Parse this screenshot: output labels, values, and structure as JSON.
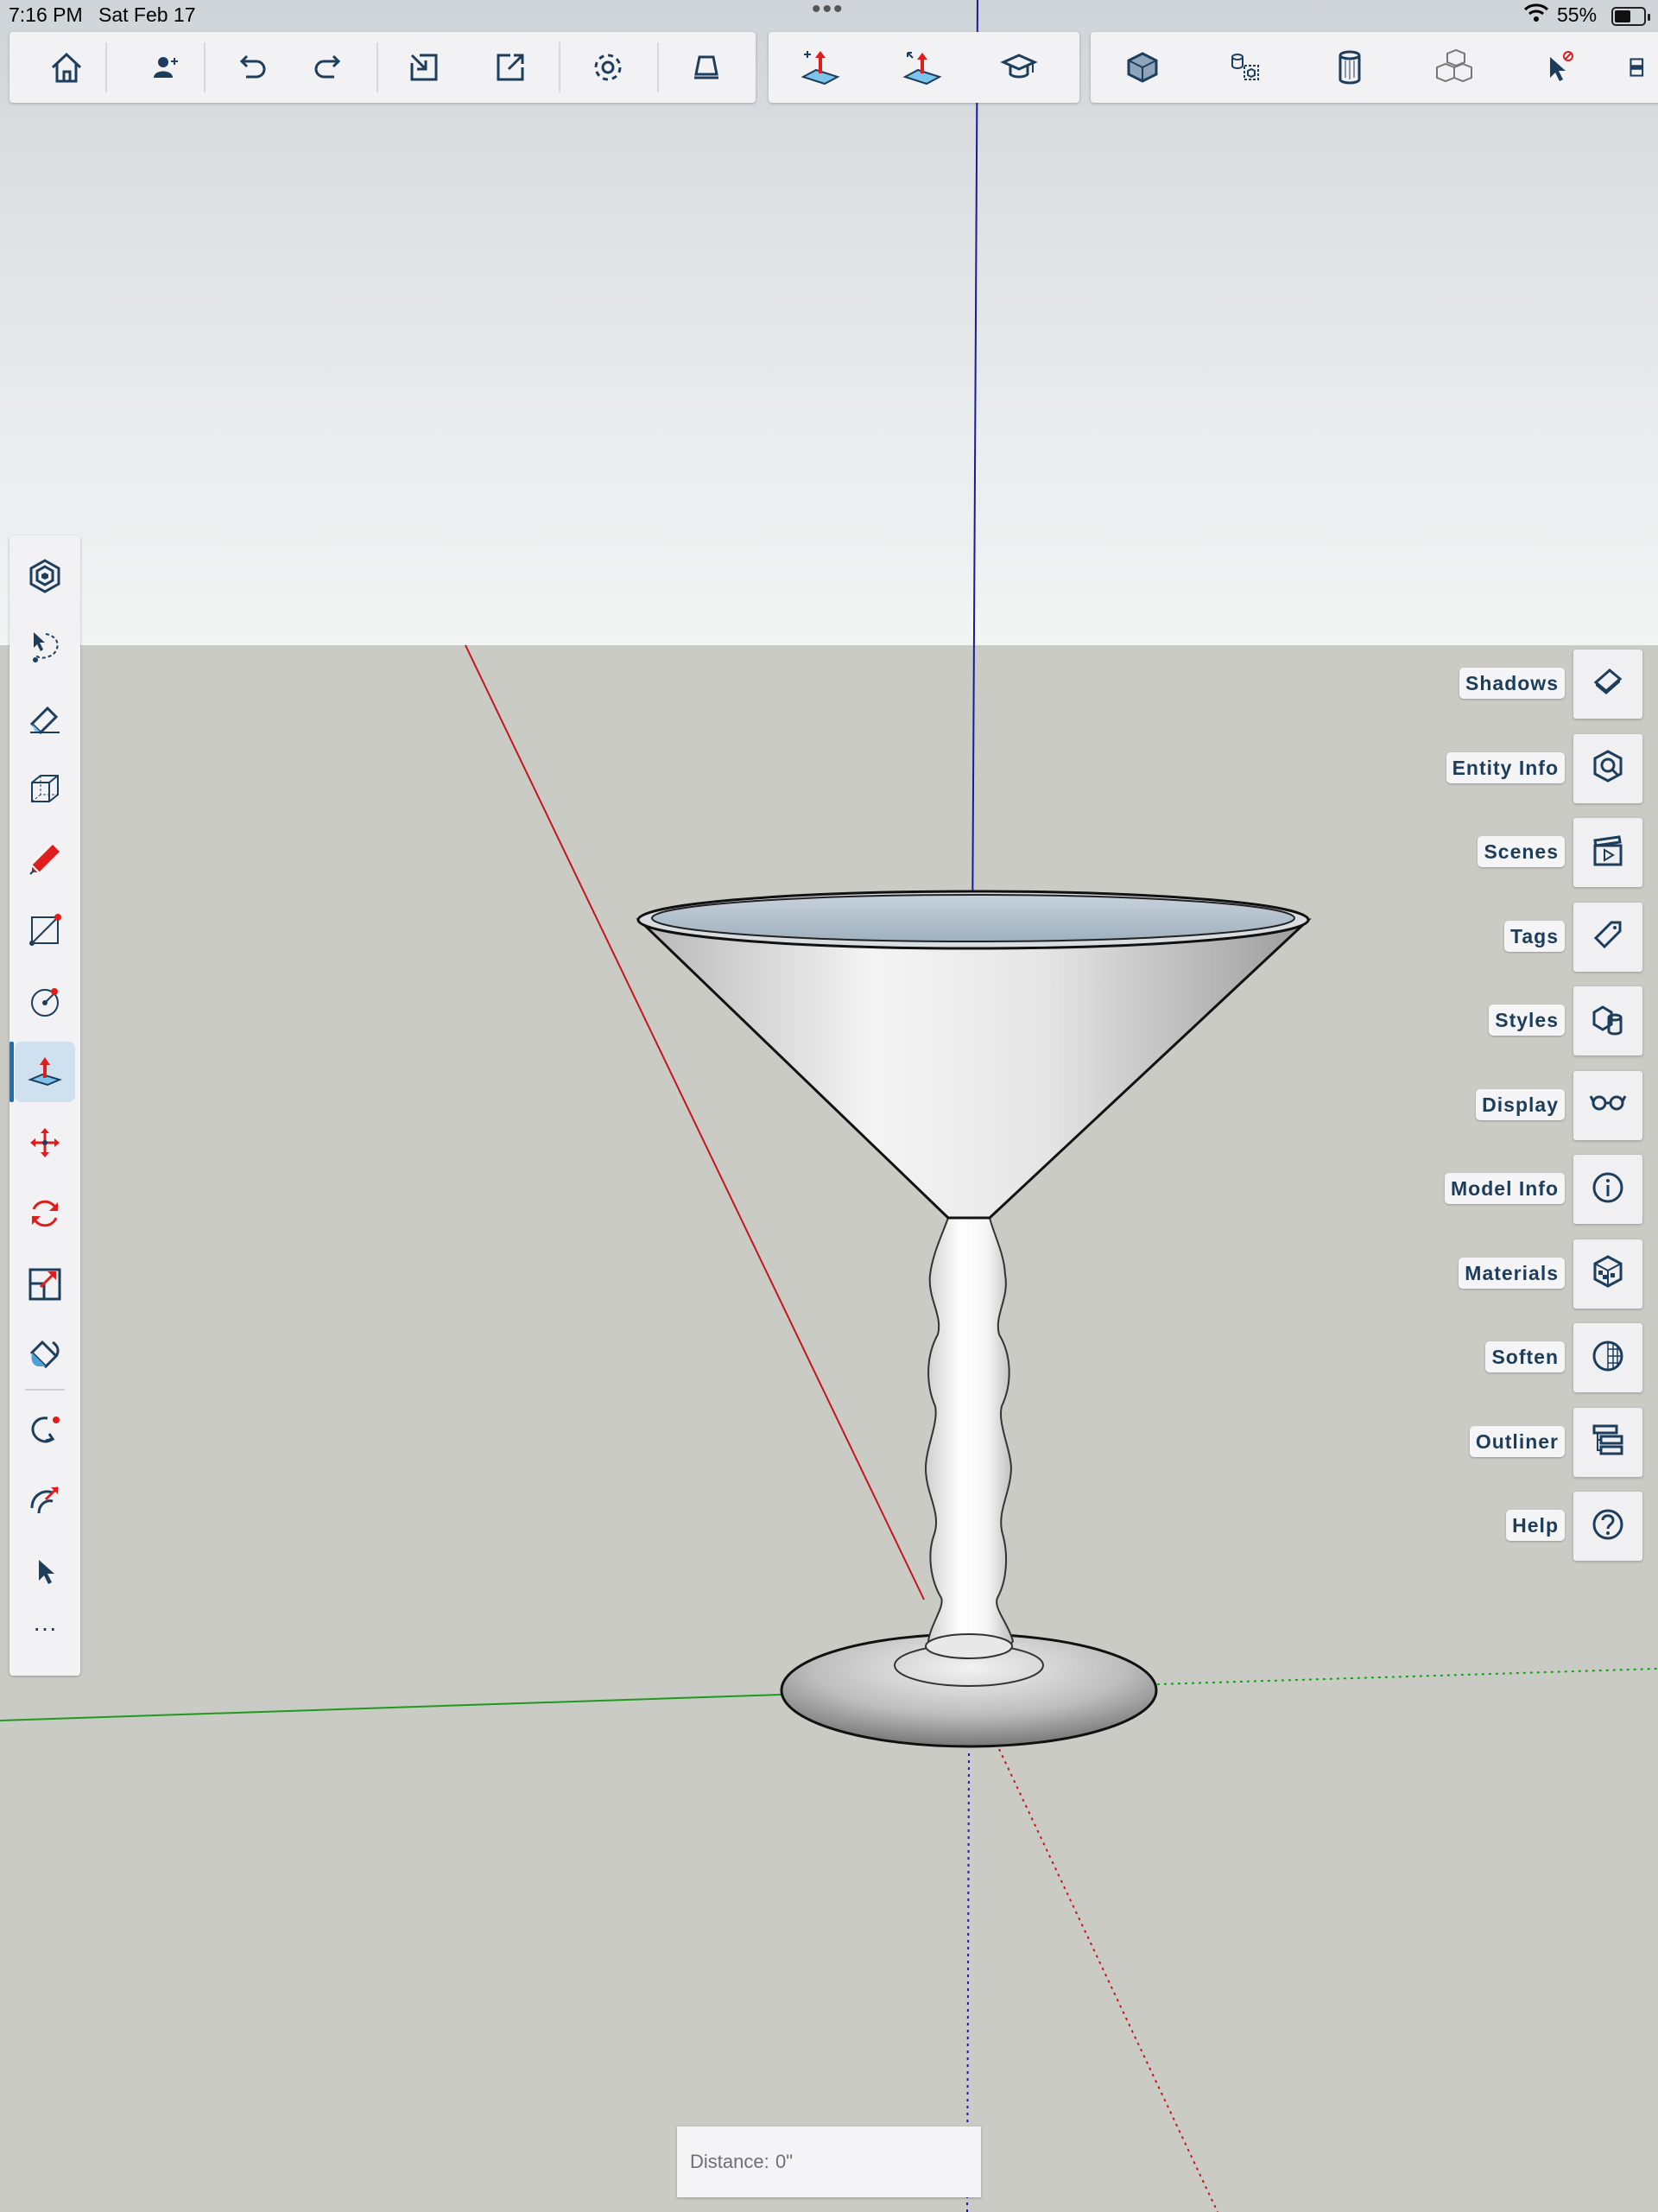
{
  "status_bar": {
    "time": "7:16 PM",
    "date": "Sat Feb 17",
    "dots": "•••",
    "battery_percent": "55%",
    "battery_level": 0.55
  },
  "top_toolbar": {
    "group1": [
      "home-icon",
      "add-user-icon",
      "undo-icon",
      "redo-icon",
      "import-icon",
      "export-icon",
      "settings-icon",
      "layout-icon"
    ],
    "group2": [
      "push-pull-icon",
      "follow-me-icon",
      "learn-icon"
    ],
    "group3": [
      "solid-tools-icon",
      "component-icon",
      "cylinder-icon",
      "boxes-icon",
      "select-filter-icon",
      "more-icon"
    ]
  },
  "left_tools": [
    "components-icon",
    "lasso-icon",
    "eraser-icon",
    "view-icon",
    "pencil-icon",
    "rectangle-icon",
    "circle-icon",
    "push-pull-icon",
    "move-icon",
    "rotate-icon",
    "scale-icon",
    "paint-bucket-icon",
    "orbit-icon",
    "tape-measure-icon",
    "select-icon"
  ],
  "left_more": "···",
  "right_panel": {
    "items": [
      {
        "label": "Shadows",
        "icon": "shadows-icon"
      },
      {
        "label": "Entity Info",
        "icon": "entity-info-icon"
      },
      {
        "label": "Scenes",
        "icon": "scenes-icon"
      },
      {
        "label": "Tags",
        "icon": "tags-icon"
      },
      {
        "label": "Styles",
        "icon": "styles-icon"
      },
      {
        "label": "Display",
        "icon": "display-icon"
      },
      {
        "label": "Model Info",
        "icon": "model-info-icon"
      },
      {
        "label": "Materials",
        "icon": "materials-icon"
      },
      {
        "label": "Soften",
        "icon": "soften-icon"
      },
      {
        "label": "Outliner",
        "icon": "outliner-icon"
      },
      {
        "label": "Help",
        "icon": "help-icon"
      }
    ]
  },
  "measurements": {
    "label": "Distance:",
    "value": "0\""
  },
  "colors": {
    "accent": "#1f6fb4",
    "icon": "#1d3d5c",
    "red_axis": "#c4151c",
    "green_axis": "#1f9a1f",
    "blue_axis": "#1a1aa0"
  }
}
